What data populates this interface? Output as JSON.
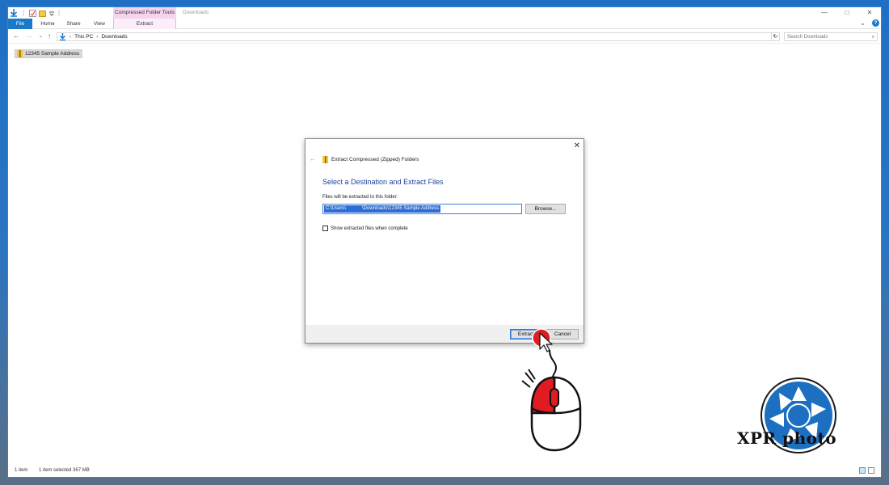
{
  "titlebar": {
    "context_tab_group": "Compressed Folder Tools",
    "window_title": "Downloads",
    "controls": {
      "minimize": "—",
      "maximize": "□",
      "close": "✕"
    }
  },
  "ribbon": {
    "tabs": [
      {
        "label": "File"
      },
      {
        "label": "Home"
      },
      {
        "label": "Share"
      },
      {
        "label": "View"
      },
      {
        "label": "Extract"
      }
    ],
    "expand_glyph": "⌄",
    "help_glyph": "?"
  },
  "address_bar": {
    "back": "←",
    "forward": "→",
    "recent": "⌄",
    "up": "↑",
    "breadcrumb": [
      "This PC",
      "Downloads"
    ],
    "breadcrumb_sep": "›",
    "dropdown_glyph": "⌄",
    "refresh_glyph": "↻",
    "search_placeholder": "Search Downloads",
    "search_glyph": "⌕"
  },
  "files": [
    {
      "name": "12345 Sample Address",
      "icon": "zip-folder-icon"
    }
  ],
  "status_bar": {
    "item_count": "1 item",
    "selection": "1 item selected  367 MB"
  },
  "dialog": {
    "title": "Extract Compressed (Zipped) Folders",
    "heading": "Select a Destination and Extract Files",
    "path_label": "Files will be extracted to this folder:",
    "path_value": "C:\\Users\\            \\Downloads\\12345 Sample Address",
    "browse_label": "Browse...",
    "checkbox_label": "Show extracted files when complete",
    "checkbox_checked": false,
    "extract_label": "Extract",
    "cancel_label": "Cancel",
    "close_glyph": "✕",
    "back_glyph": "←"
  },
  "watermark": {
    "text": "XPR photo"
  },
  "colors": {
    "accent": "#1979ca",
    "context_tab": "#f6d4ef",
    "heading_blue": "#1a3f9e",
    "selection_blue": "#2b6cd6",
    "cursor_red": "#e11b22"
  }
}
